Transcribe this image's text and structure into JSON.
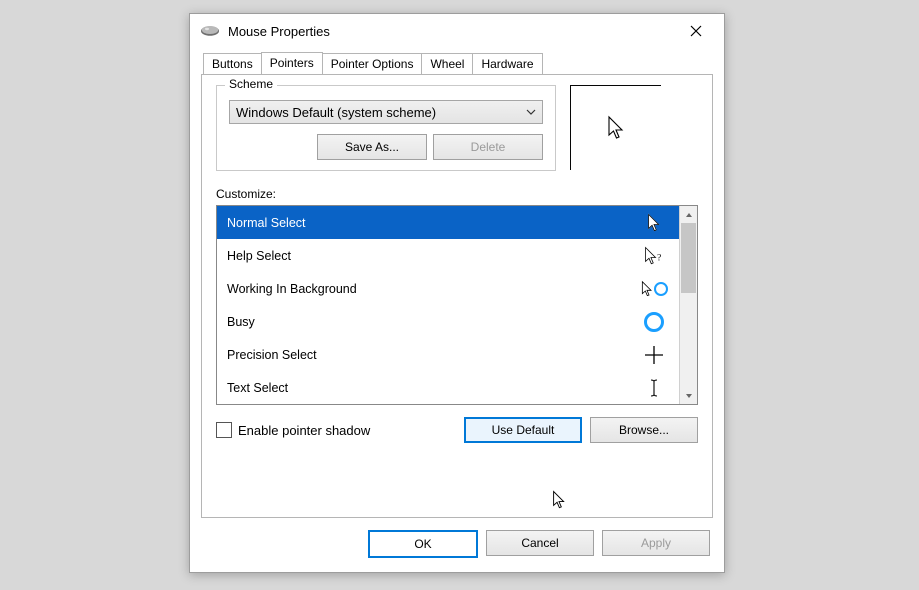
{
  "window": {
    "title": "Mouse Properties"
  },
  "tabs": {
    "t0": "Buttons",
    "t1": "Pointers",
    "t2": "Pointer Options",
    "t3": "Wheel",
    "t4": "Hardware"
  },
  "scheme": {
    "group_label": "Scheme",
    "selected": "Windows Default (system scheme)",
    "save_as": "Save As...",
    "delete": "Delete"
  },
  "customize_label": "Customize:",
  "items": {
    "i0": "Normal Select",
    "i1": "Help Select",
    "i2": "Working In Background",
    "i3": "Busy",
    "i4": "Precision Select",
    "i5": "Text Select"
  },
  "checkbox_label": "Enable pointer shadow",
  "buttons": {
    "use_default": "Use Default",
    "browse": "Browse...",
    "ok": "OK",
    "cancel": "Cancel",
    "apply": "Apply"
  }
}
